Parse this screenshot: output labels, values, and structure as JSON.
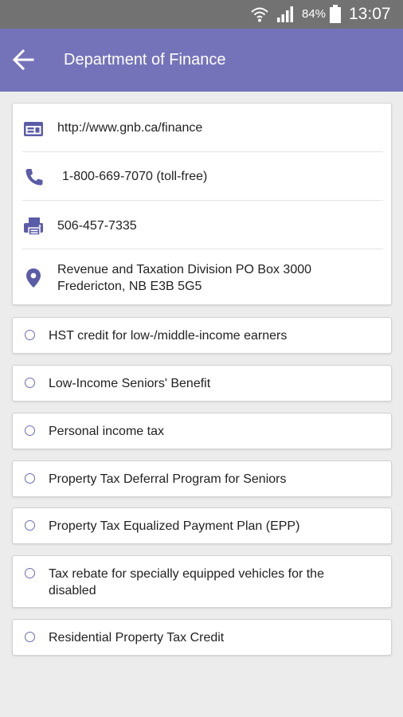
{
  "status_bar": {
    "battery": "84%",
    "time": "13:07",
    "icons": [
      "wifi-icon",
      "signal-icon",
      "battery-icon"
    ]
  },
  "app_bar": {
    "title": "Department of Finance",
    "back_icon": "back-arrow-icon"
  },
  "contact": {
    "website": "http://www.gnb.ca/finance",
    "phone": "1-800-669-7070 (toll-free)",
    "fax": "506-457-7335",
    "address_line1": "Revenue and Taxation Division PO Box 3000",
    "address_line2": "Fredericton, NB E3B 5G5",
    "icons": [
      "web-icon",
      "phone-icon",
      "fax-icon",
      "location-pin-icon"
    ]
  },
  "topics": [
    {
      "lines": [
        "HST credit for low-/middle-income earners"
      ]
    },
    {
      "lines": [
        "Low-Income Seniors' Benefit"
      ]
    },
    {
      "lines": [
        "Personal income tax"
      ]
    },
    {
      "lines": [
        "Property Tax Deferral Program for Seniors"
      ]
    },
    {
      "lines": [
        "Property Tax Equalized Payment Plan (EPP)"
      ]
    },
    {
      "lines": [
        "Tax rebate for specially equipped vehicles for the",
        "disabled"
      ]
    },
    {
      "lines": [
        "Residential Property Tax Credit"
      ]
    }
  ],
  "colors": {
    "accent": "#7473ba",
    "icon": "#5b5ca8",
    "status_bar": "#727272"
  }
}
